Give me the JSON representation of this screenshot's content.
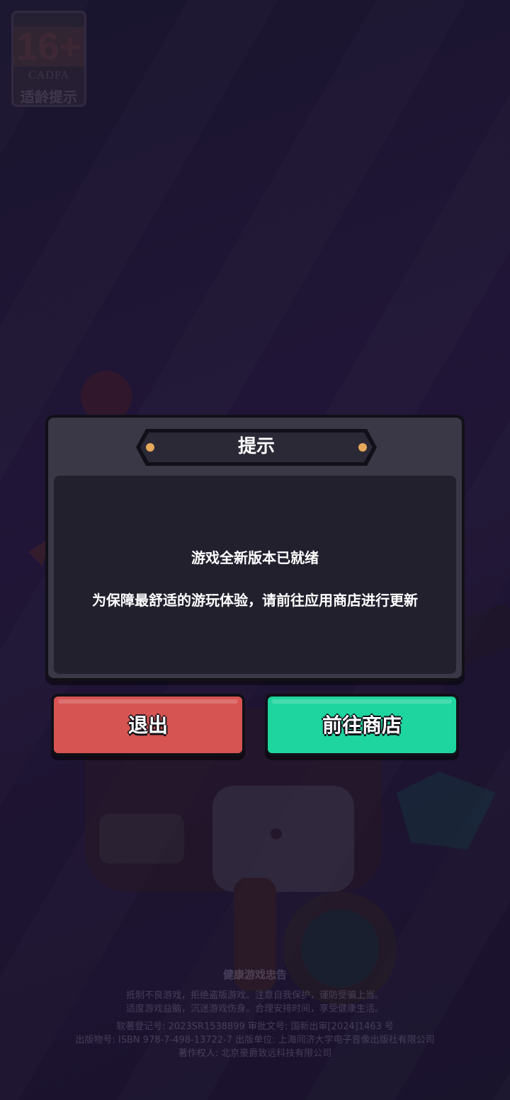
{
  "age_badge": {
    "rating": "16+",
    "org": "CADPA",
    "caption": "适龄提示"
  },
  "dialog": {
    "title": "提示",
    "message_line1": "游戏全新版本已就绪",
    "message_line2": "为保障最舒适的游玩体验，请前往应用商店进行更新"
  },
  "buttons": {
    "exit_label": "退出",
    "store_label": "前往商店"
  },
  "footer": {
    "title": "健康游戏忠告",
    "advice_1": "抵制不良游戏，拒绝盗版游戏。注意自我保护，谨防受骗上当。",
    "advice_2": "适度游戏益脑，沉迷游戏伤身。合理安排时间，享受健康生活。",
    "reg_line": "软著登记号: 2023SR1538899 审批文号: 国新出审[2024]1463 号",
    "pub_line": "出版物号: ISBN 978-7-498-13722-7 出版单位: 上海同济大学电子音像出版社有限公司",
    "copyright_line": "著作权人: 北京豪爵致远科技有限公司"
  },
  "colors": {
    "exit_button": "#d65452",
    "store_button": "#1fd59f",
    "dialog_frame": "#3a3746",
    "dialog_body": "#23202e"
  }
}
